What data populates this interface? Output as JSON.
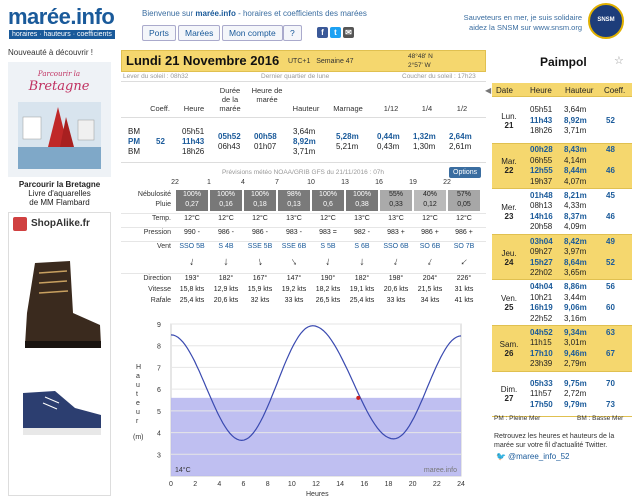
{
  "header": {
    "logo": "marée.info",
    "tagline": "horaires · hauteurs · coefficients",
    "welcome_prefix": "Bienvenue sur ",
    "welcome_site": "marée.info",
    "welcome_suffix": " - horaires et coefficients des marées",
    "nav": [
      "Ports",
      "Marées",
      "Mon compte",
      "?"
    ],
    "snsm_line1": "Sauveteurs en mer, je suis solidaire",
    "snsm_line2": "aidez la SNSM sur www.snsm.org",
    "snsm_logo": "SNSM"
  },
  "ad": {
    "title": "Nouveauté à découvrir !",
    "book_title": "Parcourir la Bretagne",
    "caption_bold": "Parcourir la Bretagne",
    "caption_1": "Livre d'aquarelles",
    "caption_2": "de MM Flambard",
    "shop": "ShopAlike.fr"
  },
  "day": {
    "name": "Lundi 21 Novembre 2016",
    "utc": "UTC+1",
    "week": "Semaine 47",
    "lat": "48°48' N",
    "lon": "2°57' W",
    "city": "Paimpol",
    "sunrise": "Lever du soleil : 08h32",
    "moon": "Dernier quartier de lune",
    "sunset": "Coucher du soleil : 17h23"
  },
  "tide_table": {
    "headers": [
      "Coeff.",
      "Heure",
      "Durée de la marée",
      "Heure de marée",
      "Hauteur",
      "Marnage",
      "1/12",
      "1/4",
      "1/2"
    ],
    "labels": [
      "BM",
      "PM",
      "BM"
    ],
    "coeff": "52",
    "heure": [
      "05h51",
      "11h43",
      "18h26"
    ],
    "duree": [
      "05h52",
      "06h43"
    ],
    "heure_maree": [
      "00h58",
      "01h07"
    ],
    "hauteur": [
      "3,64m",
      "8,92m",
      "3,71m"
    ],
    "marnage": [
      "5,28m",
      "5,21m"
    ],
    "twelfth": [
      "0,44m",
      "0,43m"
    ],
    "quarter": [
      "1,32m",
      "1,30m"
    ],
    "half": [
      "2,64m",
      "2,61m"
    ]
  },
  "meteo": {
    "title": "Prévisions météo NOAA/GRIB GFS du 21/11/2016 : 07h",
    "options": "Options",
    "hours": [
      "22",
      "1",
      "4",
      "7",
      "10",
      "13",
      "16",
      "19",
      "22"
    ],
    "row_labels": [
      "Nébulosité",
      "Pluie",
      "Temp.",
      "Pression",
      "Vent",
      "Direction",
      "Vitesse",
      "Rafale"
    ],
    "nebulosite": [
      "100%",
      "100%",
      "100%",
      "98%",
      "100%",
      "100%",
      "55%",
      "40%",
      "57%"
    ],
    "pluie": [
      "0,27",
      "0,16",
      "0,18",
      "0,13",
      "0,6",
      "0,38",
      "0,33",
      "0,12",
      "0,05"
    ],
    "temp": [
      "12°C",
      "12°C",
      "12°C",
      "13°C",
      "12°C",
      "13°C",
      "13°C",
      "12°C",
      "12°C"
    ],
    "pression": [
      "990 -",
      "986 -",
      "986 -",
      "983 -",
      "983 =",
      "982 -",
      "983 +",
      "986 +",
      "986 +"
    ],
    "vent": [
      "SSO 5B",
      "S 4B",
      "SSE 5B",
      "SSE 6B",
      "S 5B",
      "S 6B",
      "SSO 6B",
      "SO 6B",
      "SO 7B"
    ],
    "direction": [
      "193°",
      "182°",
      "167°",
      "147°",
      "190°",
      "182°",
      "198°",
      "204°",
      "226°"
    ],
    "vitesse": [
      "15,8 kts",
      "12,9 kts",
      "15,9 kts",
      "19,2 kts",
      "18,2 kts",
      "19,1 kts",
      "20,6 kts",
      "21,5 kts",
      "31 kts"
    ],
    "rafale": [
      "25,4 kts",
      "20,6 kts",
      "32 kts",
      "33 kts",
      "26,5 kts",
      "25,4 kts",
      "33 kts",
      "34 kts",
      "41 kts"
    ]
  },
  "chart_data": {
    "type": "line",
    "title": "",
    "xlabel": "Heures",
    "ylabel": "Hauteur (m)",
    "xlim": [
      0,
      24
    ],
    "ylim": [
      2,
      9
    ],
    "x_ticks": [
      0,
      2,
      4,
      6,
      8,
      10,
      12,
      14,
      16,
      18,
      20,
      22,
      24
    ],
    "y_ticks": [
      3,
      4,
      5,
      6,
      7,
      8,
      9
    ],
    "water_temp": "14°C",
    "watermark": "maree.info",
    "current_level": 5.6,
    "current_hour": 15.5,
    "extrema": [
      {
        "x": 0,
        "y": 8.5
      },
      {
        "x": 5.85,
        "y": 3.64
      },
      {
        "x": 11.72,
        "y": 8.92
      },
      {
        "x": 18.43,
        "y": 3.71
      },
      {
        "x": 24,
        "y": 8.45
      }
    ]
  },
  "right_panel": {
    "headers": [
      "Date",
      "Heure",
      "Hauteur",
      "Coeff."
    ],
    "days": [
      {
        "dow": "Lun.",
        "num": "21",
        "times": [
          "05h51",
          "11h43",
          "18h26"
        ],
        "heights": [
          "3,64m",
          "8,92m",
          "3,71m"
        ],
        "coeffs": [
          "",
          "52",
          ""
        ],
        "pm": 1,
        "hl": false
      },
      {
        "dow": "Mar.",
        "num": "22",
        "times": [
          "00h28",
          "06h55",
          "12h55",
          "19h37"
        ],
        "heights": [
          "8,43m",
          "4,14m",
          "8,44m",
          "4,07m"
        ],
        "coeffs": [
          "48",
          "",
          "46",
          ""
        ],
        "pm": [
          0,
          2
        ],
        "hl": true
      },
      {
        "dow": "Mer.",
        "num": "23",
        "times": [
          "01h48",
          "08h13",
          "14h16",
          "20h58"
        ],
        "heights": [
          "8,21m",
          "4,33m",
          "8,37m",
          "4,09m"
        ],
        "coeffs": [
          "45",
          "",
          "46",
          ""
        ],
        "pm": [
          0,
          2
        ],
        "hl": false
      },
      {
        "dow": "Jeu.",
        "num": "24",
        "times": [
          "03h04",
          "09h27",
          "15h27",
          "22h02"
        ],
        "heights": [
          "8,42m",
          "3,97m",
          "8,64m",
          "3,65m"
        ],
        "coeffs": [
          "49",
          "",
          "52",
          ""
        ],
        "pm": [
          0,
          2
        ],
        "hl": true
      },
      {
        "dow": "Ven.",
        "num": "25",
        "times": [
          "04h04",
          "10h21",
          "16h19",
          "22h52"
        ],
        "heights": [
          "8,86m",
          "3,44m",
          "9,06m",
          "3,16m"
        ],
        "coeffs": [
          "56",
          "",
          "60",
          ""
        ],
        "pm": [
          0,
          2
        ],
        "hl": false
      },
      {
        "dow": "Sam.",
        "num": "26",
        "times": [
          "04h52",
          "11h15",
          "17h10",
          "23h39"
        ],
        "heights": [
          "9,34m",
          "3,01m",
          "9,46m",
          "2,79m"
        ],
        "coeffs": [
          "63",
          "",
          "67",
          ""
        ],
        "pm": [
          0,
          2
        ],
        "hl": true
      },
      {
        "dow": "Dim.",
        "num": "27",
        "times": [
          "05h33",
          "11h57",
          "17h50"
        ],
        "heights": [
          "9,75m",
          "2,72m",
          "9,79m"
        ],
        "coeffs": [
          "70",
          "",
          "73"
        ],
        "pm": [
          0,
          2
        ],
        "hl": false
      }
    ],
    "legend_pm": "PM : Pleine Mer",
    "legend_bm": "BM : Basse Mer",
    "twitter_text": "Retrouvez les heures et hauteurs de la marée sur votre fil d'actualité Twitter.",
    "twitter_handle": "@maree_info_52"
  },
  "colors": {
    "accent": "#1a5a9a",
    "highlight": "#f5d76e",
    "water": "#b8b8f0",
    "curve": "#3a4ab0"
  }
}
